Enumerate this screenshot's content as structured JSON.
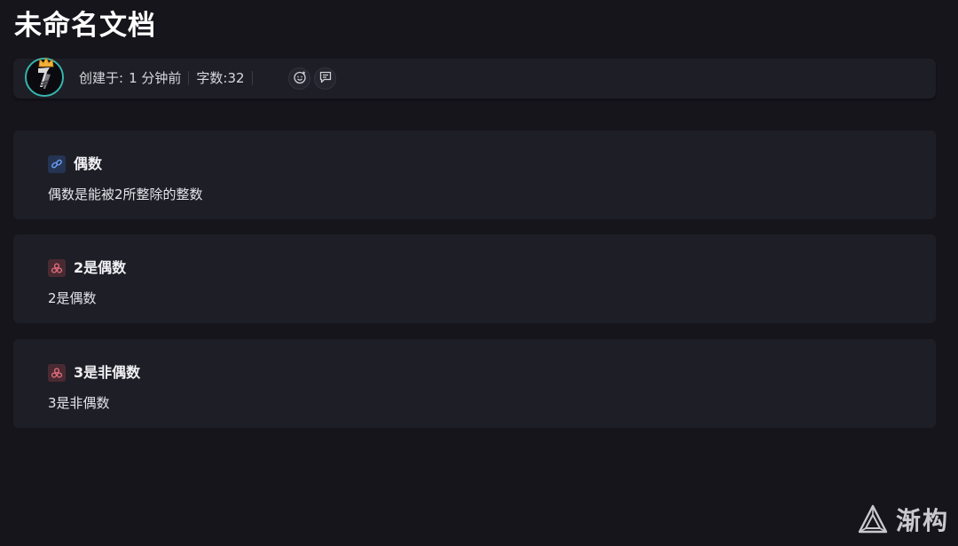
{
  "document": {
    "title": "未命名文档"
  },
  "meta": {
    "created_label": "创建于:",
    "created_value": "1 分钟前",
    "word_count_label": "字数:",
    "word_count_value": "32",
    "icons": [
      "avatar",
      "crown-icon",
      "emoji-reaction-icon",
      "comment-icon"
    ]
  },
  "cards": [
    {
      "icon": "link-icon",
      "title": "偶数",
      "body": "偶数是能被2所整除的整数"
    },
    {
      "icon": "node-icon",
      "title": "2是偶数",
      "body": "2是偶数"
    },
    {
      "icon": "node-icon",
      "title": "3是非偶数",
      "body": "3是非偶数"
    }
  ],
  "watermark": {
    "text": "渐构"
  },
  "colors": {
    "background": "#16151c",
    "panel": "#1e1e26",
    "avatar_ring": "#36b7b0",
    "link_icon": "#5b8ff0",
    "node_icon": "#e26a7a"
  }
}
